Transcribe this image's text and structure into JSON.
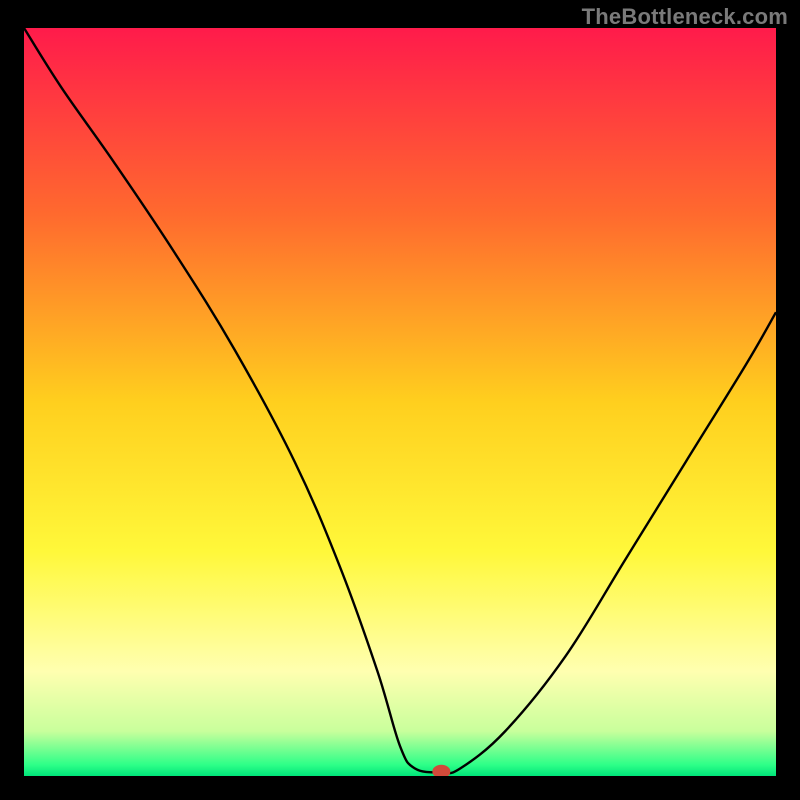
{
  "watermark": "TheBottleneck.com",
  "chart_data": {
    "type": "line",
    "title": "",
    "xlabel": "",
    "ylabel": "",
    "xlim": [
      0,
      100
    ],
    "ylim": [
      0,
      100
    ],
    "grid": false,
    "legend": false,
    "background": {
      "type": "vertical-gradient",
      "stops": [
        {
          "pos": 0.0,
          "color": "#ff1b4b"
        },
        {
          "pos": 0.25,
          "color": "#ff6a2e"
        },
        {
          "pos": 0.5,
          "color": "#ffcf1e"
        },
        {
          "pos": 0.7,
          "color": "#fff83a"
        },
        {
          "pos": 0.86,
          "color": "#ffffb0"
        },
        {
          "pos": 0.94,
          "color": "#c9ff9c"
        },
        {
          "pos": 0.985,
          "color": "#2eff88"
        },
        {
          "pos": 1.0,
          "color": "#00e47a"
        }
      ]
    },
    "series": [
      {
        "name": "bottleneck-curve",
        "stroke": "#000000",
        "stroke_width": 2.4,
        "x": [
          0,
          5,
          12,
          20,
          28,
          36,
          42,
          47,
          50,
          52,
          55.5,
          58,
          64,
          72,
          80,
          88,
          96,
          100
        ],
        "y": [
          100,
          92,
          82,
          70,
          57,
          42,
          28,
          14,
          4,
          1,
          0.5,
          1,
          6,
          16,
          29,
          42,
          55,
          62
        ]
      }
    ],
    "marker": {
      "name": "min-point",
      "x": 55.5,
      "y": 0.6,
      "rx": 1.2,
      "ry": 0.9,
      "fill": "#d24a3a"
    }
  }
}
